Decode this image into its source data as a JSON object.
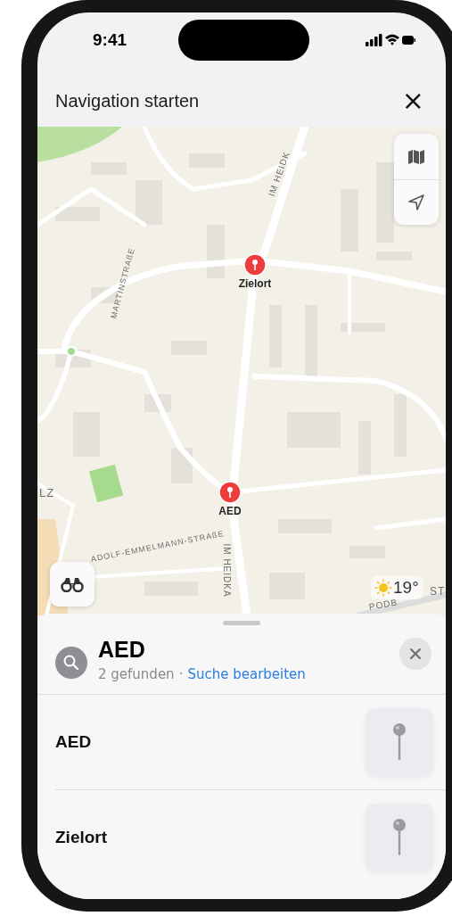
{
  "status_bar": {
    "time": "9:41"
  },
  "header": {
    "title": "Navigation starten",
    "close": "×"
  },
  "map": {
    "street_labels": [
      {
        "text": "IM HEIDK"
      },
      {
        "text": "MARTINSTRAßE"
      },
      {
        "text": "ADOLF-EMMELMANN-STRAßE"
      },
      {
        "text": "IM HEIDKA"
      },
      {
        "text": "LZ"
      },
      {
        "text": "PODB"
      },
      {
        "text": "ST"
      }
    ],
    "pins": [
      {
        "label": "Zielort"
      },
      {
        "label": "AED"
      }
    ],
    "weather": {
      "temperature": "19°"
    }
  },
  "results": {
    "query": "AED",
    "count": "2 gefunden",
    "separator": "·",
    "edit_link": "Suche bearbeiten",
    "items": [
      {
        "name": "AED"
      },
      {
        "name": "Zielort"
      }
    ]
  }
}
